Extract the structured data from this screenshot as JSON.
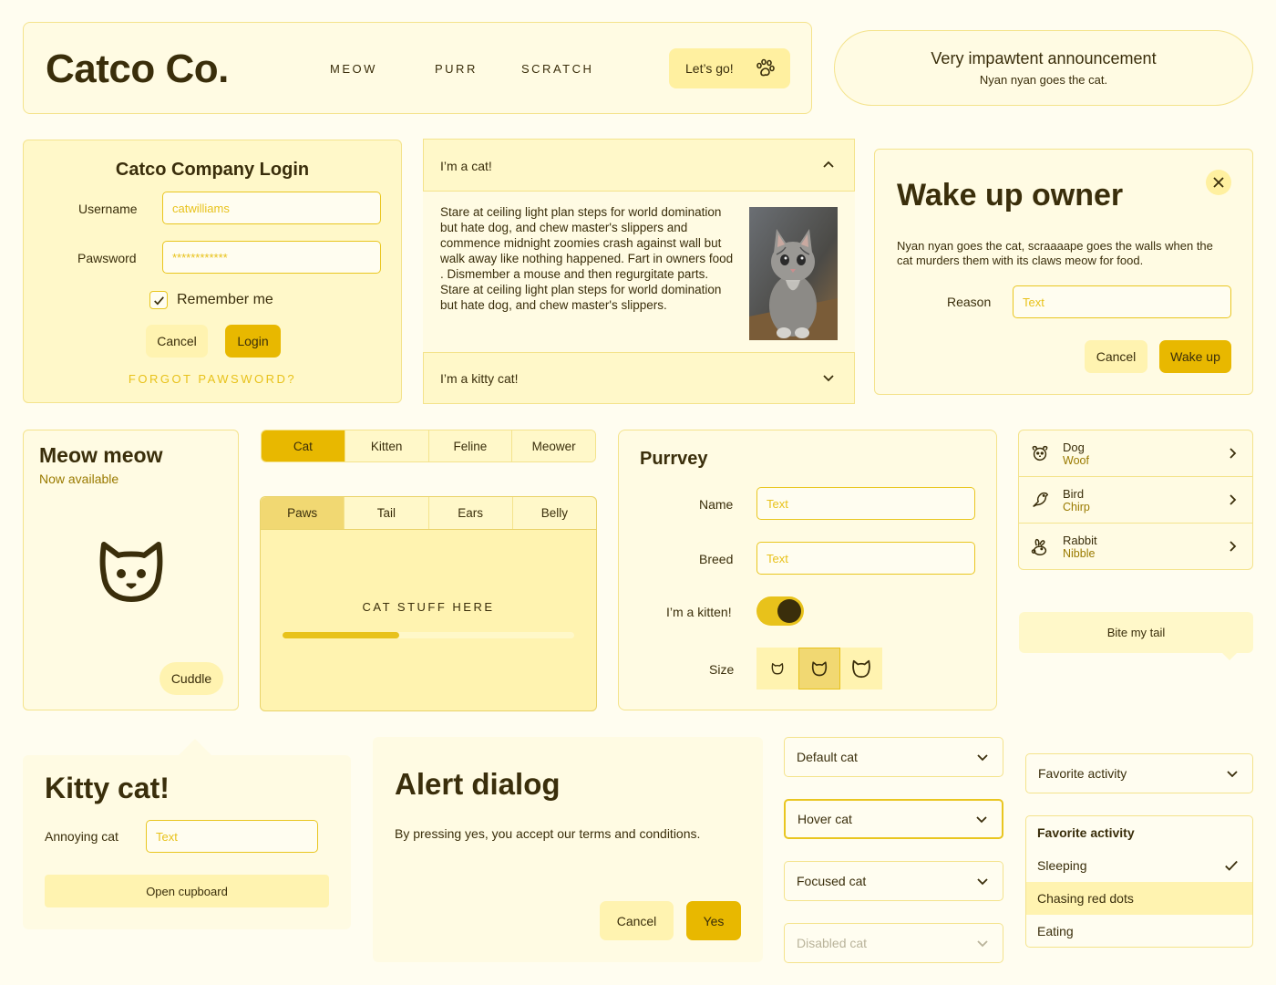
{
  "header": {
    "brand": "Catco Co.",
    "nav": [
      "MEOW",
      "PURR",
      "SCRATCH"
    ],
    "cta_label": "Let’s go!"
  },
  "announcement": {
    "title": "Very impawtent announcement",
    "subtitle": "Nyan nyan goes the cat."
  },
  "login": {
    "title": "Catco Company Login",
    "username_label": "Username",
    "username_value": "catwilliams",
    "password_label": "Pawsword",
    "password_value": "************",
    "remember_label": "Remember me",
    "cancel_label": "Cancel",
    "login_label": "Login",
    "forgot_label": "FORGOT PAWSWORD?"
  },
  "accordion": {
    "item1_title": "I’m a cat!",
    "item1_body": "Stare at ceiling light plan steps for world domination but hate dog, and chew master's slippers and commence midnight zoomies crash against wall but walk away like nothing happened. Fart in owners food . Dismember a mouse and then regurgitate parts. Stare at ceiling light plan steps for world domination but hate dog, and chew master's slippers.",
    "item2_title": "I’m a kitty cat!"
  },
  "wake_dialog": {
    "title": "Wake up owner",
    "body": "Nyan nyan goes the cat, scraaaape goes the walls when the cat murders them with its claws meow for food.",
    "reason_label": "Reason",
    "reason_placeholder": "Text",
    "cancel_label": "Cancel",
    "confirm_label": "Wake up"
  },
  "product_card": {
    "title": "Meow meow",
    "subtitle": "Now available",
    "action_label": "Cuddle"
  },
  "segmented": [
    "Cat",
    "Kitten",
    "Feline",
    "Meower"
  ],
  "tab_panel": {
    "tabs": [
      "Paws",
      "Tail",
      "Ears",
      "Belly"
    ],
    "content": "CAT STUFF HERE",
    "progress": 0.4
  },
  "purrvey": {
    "title": "Purrvey",
    "name_label": "Name",
    "name_placeholder": "Text",
    "breed_label": "Breed",
    "breed_placeholder": "Text",
    "kitten_label": "I’m a kitten!",
    "kitten_on": true,
    "size_label": "Size"
  },
  "animal_list": [
    {
      "title": "Dog",
      "subtitle": "Woof",
      "icon": "dog-icon"
    },
    {
      "title": "Bird",
      "subtitle": "Chirp",
      "icon": "bird-icon"
    },
    {
      "title": "Rabbit",
      "subtitle": "Nibble",
      "icon": "rabbit-icon"
    }
  ],
  "tooltip": {
    "text": "Bite my tail"
  },
  "popover": {
    "title": "Kitty cat!",
    "field_label": "Annoying cat",
    "field_placeholder": "Text",
    "action_label": "Open cupboard"
  },
  "alert": {
    "title": "Alert dialog",
    "body": "By pressing yes, you accept our terms and conditions.",
    "cancel_label": "Cancel",
    "yes_label": "Yes"
  },
  "selects": {
    "default": "Default cat",
    "hover": "Hover cat",
    "focused": "Focused cat",
    "disabled": "Disabled cat"
  },
  "activity": {
    "collapsed_label": "Favorite activity",
    "menu_title": "Favorite activity",
    "options": [
      "Sleeping",
      "Chasing red dots",
      "Eating"
    ]
  },
  "colors": {
    "accent": "#e8b800",
    "surface": "#fff8c9",
    "border": "#f4e38c",
    "text": "#3a2e0b"
  }
}
